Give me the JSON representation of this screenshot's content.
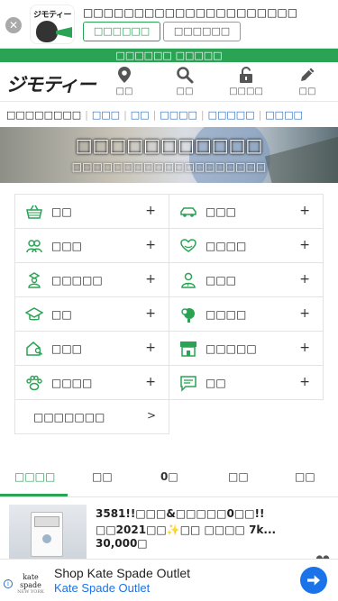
{
  "app_banner": {
    "close_label": "✕",
    "brand": "ジモティー",
    "title": "□□□□□□□□□□□□□□□□□□□□□",
    "install_label": "□□□□□□",
    "open_label": "□□□□□□"
  },
  "notice": {
    "text": "□□□□□□ □□□□□"
  },
  "header": {
    "logo": "ジモティー",
    "nav": [
      {
        "label": "□□",
        "icon": "location-pin-icon"
      },
      {
        "label": "□□",
        "icon": "search-icon"
      },
      {
        "label": "□□□□",
        "icon": "unlock-icon"
      },
      {
        "label": "□□",
        "icon": "pencil-icon"
      }
    ]
  },
  "category_strip": {
    "first": "□□□□□□□□",
    "links": [
      "□□□",
      "□□",
      "□□□□",
      "□□□□□",
      "□□□□"
    ]
  },
  "hero": {
    "title": "□□□□□□□□□□□",
    "subtitle": "□□□□□□□□□□□□□□□□□□□"
  },
  "categories": [
    {
      "label": "□□",
      "icon": "basket-icon",
      "toggle": "+"
    },
    {
      "label": "□□□",
      "icon": "car-icon",
      "toggle": "+"
    },
    {
      "label": "□□□",
      "icon": "people-icon",
      "toggle": "+"
    },
    {
      "label": "□□□□",
      "icon": "heart-hands-icon",
      "toggle": "+"
    },
    {
      "label": "□□□□□",
      "icon": "teacher-icon",
      "toggle": "+"
    },
    {
      "label": "□□□",
      "icon": "worker-icon",
      "toggle": "+"
    },
    {
      "label": "□□",
      "icon": "graduation-cap-icon",
      "toggle": "+"
    },
    {
      "label": "□□□□",
      "icon": "pet-icon",
      "toggle": "+"
    },
    {
      "label": "□□□",
      "icon": "house-search-icon",
      "toggle": "+"
    },
    {
      "label": "□□□□□",
      "icon": "shop-icon",
      "toggle": "+"
    },
    {
      "label": "□□□□",
      "icon": "paw-icon",
      "toggle": "+"
    },
    {
      "label": "□□",
      "icon": "chat-icon",
      "toggle": "+"
    }
  ],
  "more_categories": {
    "label": "□□□□□□□",
    "arrow": ">"
  },
  "tabs": [
    {
      "label": "□□□□",
      "active": true
    },
    {
      "label": "□□",
      "active": false
    },
    {
      "label": "0□",
      "active": false
    },
    {
      "label": "□□",
      "active": false
    },
    {
      "label": "□□",
      "active": false
    }
  ],
  "listing": {
    "title": "3581!!□□□&□□□□□0□□!!□□2021□□✨□□ □□□□ 7k...",
    "price": "30,000□"
  },
  "ad": {
    "info": "i",
    "brand": "kate spade",
    "brand_sub": "NEW YORK",
    "headline": "Shop Kate Spade Outlet",
    "subline": "Kate Spade Outlet"
  },
  "colors": {
    "accent": "#2aa354",
    "link": "#2a6ebb",
    "ad_blue": "#1a73e8"
  }
}
